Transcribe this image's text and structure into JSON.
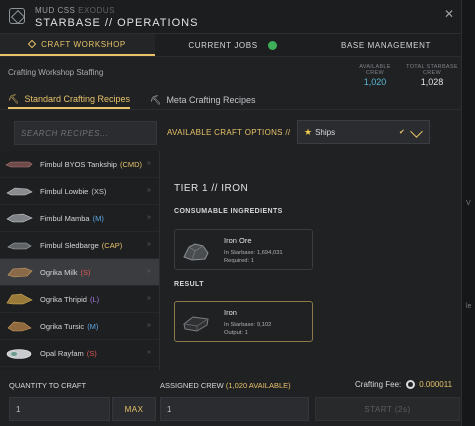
{
  "header": {
    "subtitle_main": "MUD CSS",
    "subtitle_accent": "EXODUS",
    "title": "STARBASE // OPERATIONS",
    "close": "✕"
  },
  "tabs": [
    {
      "label": "CRAFT WORKSHOP",
      "active": true
    },
    {
      "label": "CURRENT JOBS",
      "active": false,
      "badge_color": "#3fae58"
    },
    {
      "label": "BASE MANAGEMENT",
      "active": false
    }
  ],
  "staffing": {
    "label": "Crafting Workshop Staffing",
    "available_crew_label": "AVAILABLE CREW",
    "available_crew": "1,020",
    "total_crew_label": "TOTAL STARBASE CREW",
    "total_crew": "1,028"
  },
  "subtabs": [
    {
      "label": "Standard Crafting Recipes",
      "active": true
    },
    {
      "label": "Meta Crafting Recipes",
      "active": false
    }
  ],
  "search": {
    "placeholder": "SEARCH RECIPES..."
  },
  "craft_options": {
    "label": "AVAILABLE CRAFT OPTIONS //",
    "selected": "Ships"
  },
  "recipes": [
    {
      "name": "Fimbul BYOS Tankship",
      "size": "(CMD)",
      "size_color": "#e8c36a"
    },
    {
      "name": "Fimbul Lowbie",
      "size": "(XS)",
      "size_color": "#c9ccce"
    },
    {
      "name": "Fimbul Mamba",
      "size": "(M)",
      "size_color": "#5da7e6"
    },
    {
      "name": "Fimbul Sledbarge",
      "size": "(CAP)",
      "size_color": "#e8c36a"
    },
    {
      "name": "Ogrika Milk",
      "size": "(S)",
      "size_color": "#e05a5a",
      "selected": true
    },
    {
      "name": "Ogrika Thripid",
      "size": "(L)",
      "size_color": "#a47ae0"
    },
    {
      "name": "Ogrika Tursic",
      "size": "(M)",
      "size_color": "#5da7e6"
    },
    {
      "name": "Opal Rayfam",
      "size": "(S)",
      "size_color": "#e05a5a"
    }
  ],
  "detail": {
    "tier": "TIER 1 // IRON",
    "ingredients_label": "CONSUMABLE INGREDIENTS",
    "ingredient": {
      "name": "Iron Ore",
      "in_starbase": "In Starbase: 1,694,031",
      "required": "Required: 1"
    },
    "result_label": "RESULT",
    "result": {
      "name": "Iron",
      "in_starbase": "In Starbase: 9,102",
      "output": "Output: 1"
    }
  },
  "footer": {
    "quantity_label": "QUANTITY TO CRAFT",
    "quantity_value": "1",
    "max_label": "MAX",
    "assigned_label": "ASSIGNED CREW",
    "assigned_available": "(1,020 AVAILABLE)",
    "assigned_value": "1",
    "fee_label": "Crafting Fee:",
    "fee_amount": "0.000011",
    "start_label": "START (2s)"
  },
  "right_edge": {
    "letter1": "V",
    "letter2": "le"
  }
}
